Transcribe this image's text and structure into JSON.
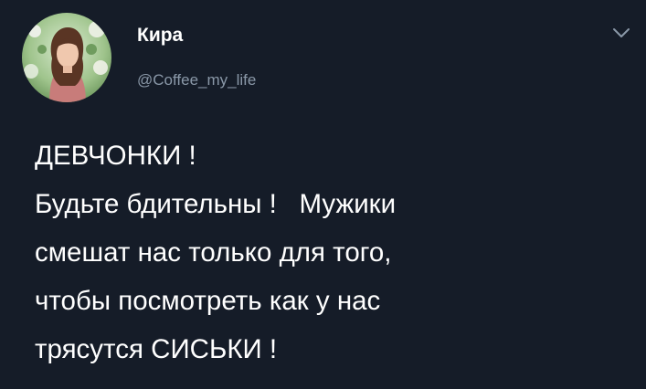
{
  "tweet": {
    "author": {
      "display_name": "Кира",
      "handle": "@Coffee_my_life",
      "avatar_icon": "profile-photo-woman-with-flowers"
    },
    "menu_icon": "chevron-down-icon",
    "text_lines": [
      "ДЕВЧОНКИ !",
      "Будьте бдительны !   Мужики",
      "смешат нас только для того,",
      "чтобы посмотреть как у нас",
      "трясутся СИСЬКИ !"
    ]
  },
  "colors": {
    "background": "#151c28",
    "text": "#ffffff",
    "handle": "#8a98a8"
  }
}
